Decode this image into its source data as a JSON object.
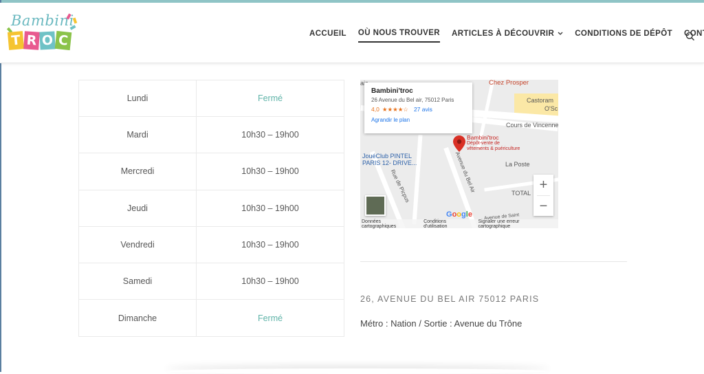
{
  "brand": {
    "logo_script": "Bambini",
    "logo_letters": [
      "T",
      "R",
      "O",
      "C"
    ]
  },
  "nav": {
    "items": [
      {
        "label": "Accueil",
        "active": false
      },
      {
        "label": "Où nous trouver",
        "active": true
      },
      {
        "label": "Articles à découvrir",
        "active": false,
        "dropdown": true
      },
      {
        "label": "Conditions de dépôt",
        "active": false
      },
      {
        "label": "Contact",
        "active": false
      }
    ],
    "search_icon": "search-icon"
  },
  "hours": [
    {
      "day": "Lundi",
      "time": "Fermé",
      "closed": true
    },
    {
      "day": "Mardi",
      "time": "10h30 – 19h00",
      "closed": false
    },
    {
      "day": "Mercredi",
      "time": "10h30 – 19h00",
      "closed": false
    },
    {
      "day": "Jeudi",
      "time": "10h30 – 19h00",
      "closed": false
    },
    {
      "day": "Vendredi",
      "time": "10h30 – 19h00",
      "closed": false
    },
    {
      "day": "Samedi",
      "time": "10h30 – 19h00",
      "closed": false
    },
    {
      "day": "Dimanche",
      "time": "Fermé",
      "closed": true
    }
  ],
  "map": {
    "card": {
      "title": "Bambini'troc",
      "address": "26 Avenue du Bel air, 75012 Paris",
      "rating": "4,0",
      "stars": "★★★★☆",
      "reviews": "27 avis",
      "link": "Agrandir le plan"
    },
    "labels": {
      "chez_prosper": "Chez Prosper",
      "castorama": "Castoram",
      "castorama2": "O'Sc",
      "cours": "Cours de Vincenne",
      "pin_title": "Bambini'troc",
      "pin_sub1": "Dépôt-vente de",
      "pin_sub2": "vêtements & puériculture",
      "joueclub1": "JouéClub PINTEL",
      "joueclub2": "PARIS 12- DRIVE...",
      "laposte": "La Poste",
      "rue_picpus": "Rue de Picpus",
      "av_bel_air": "Avenue du Bel Air",
      "total": "TOTAL",
      "av_saint": "Avenue de Saint",
      "ais": "ais"
    },
    "footer": [
      "Données cartographiques",
      "Conditions d'utilisation",
      "Signaler une erreur cartographique"
    ],
    "google": [
      "G",
      "o",
      "o",
      "g",
      "l",
      "e"
    ],
    "zoom_in": "+",
    "zoom_out": "−"
  },
  "location": {
    "address": "26, AVENUE DU BEL AIR 75012 PARIS",
    "metro": "Métro : Nation / Sortie : Avenue du Trône"
  },
  "colors": {
    "accent": "#8fc4c6",
    "closed_text": "#5fb3a8",
    "pin": "#d93025"
  }
}
